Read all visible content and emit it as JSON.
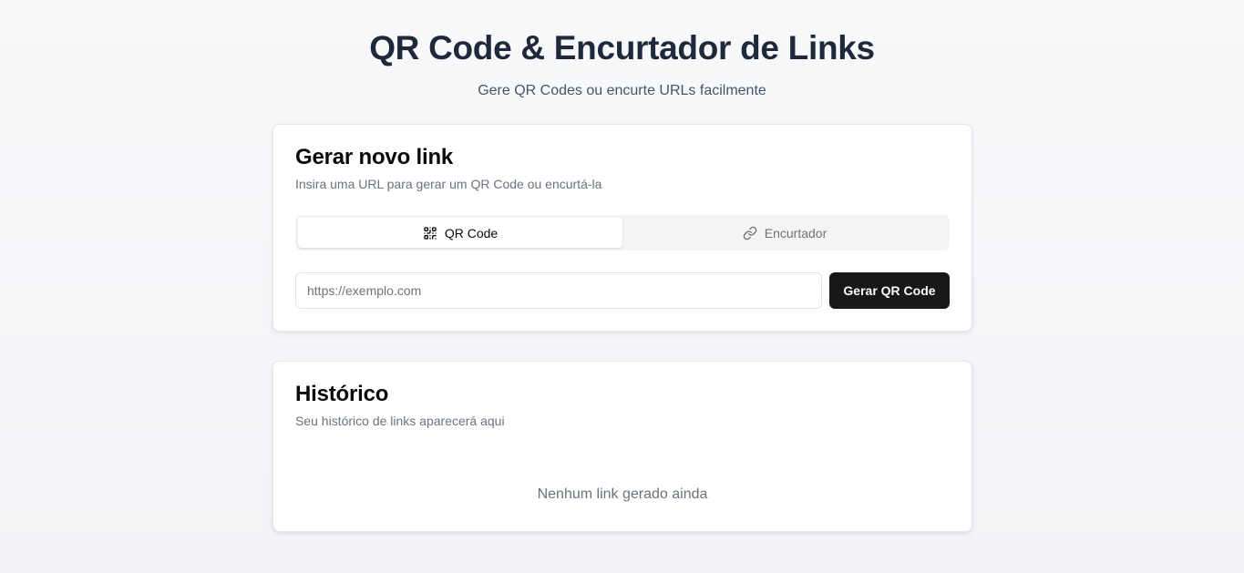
{
  "header": {
    "title": "QR Code & Encurtador de Links",
    "subtitle": "Gere QR Codes ou encurte URLs facilmente"
  },
  "generate": {
    "title": "Gerar novo link",
    "description": "Insira uma URL para gerar um QR Code ou encurtá-la",
    "tabs": [
      {
        "label": "QR Code",
        "icon": "qr-code-icon",
        "active": true
      },
      {
        "label": "Encurtador",
        "icon": "link-icon",
        "active": false
      }
    ],
    "input": {
      "value": "",
      "placeholder": "https://exemplo.com"
    },
    "button_label": "Gerar QR Code"
  },
  "history": {
    "title": "Histórico",
    "description": "Seu histórico de links aparecerá aqui",
    "empty_text": "Nenhum link gerado ainda"
  }
}
